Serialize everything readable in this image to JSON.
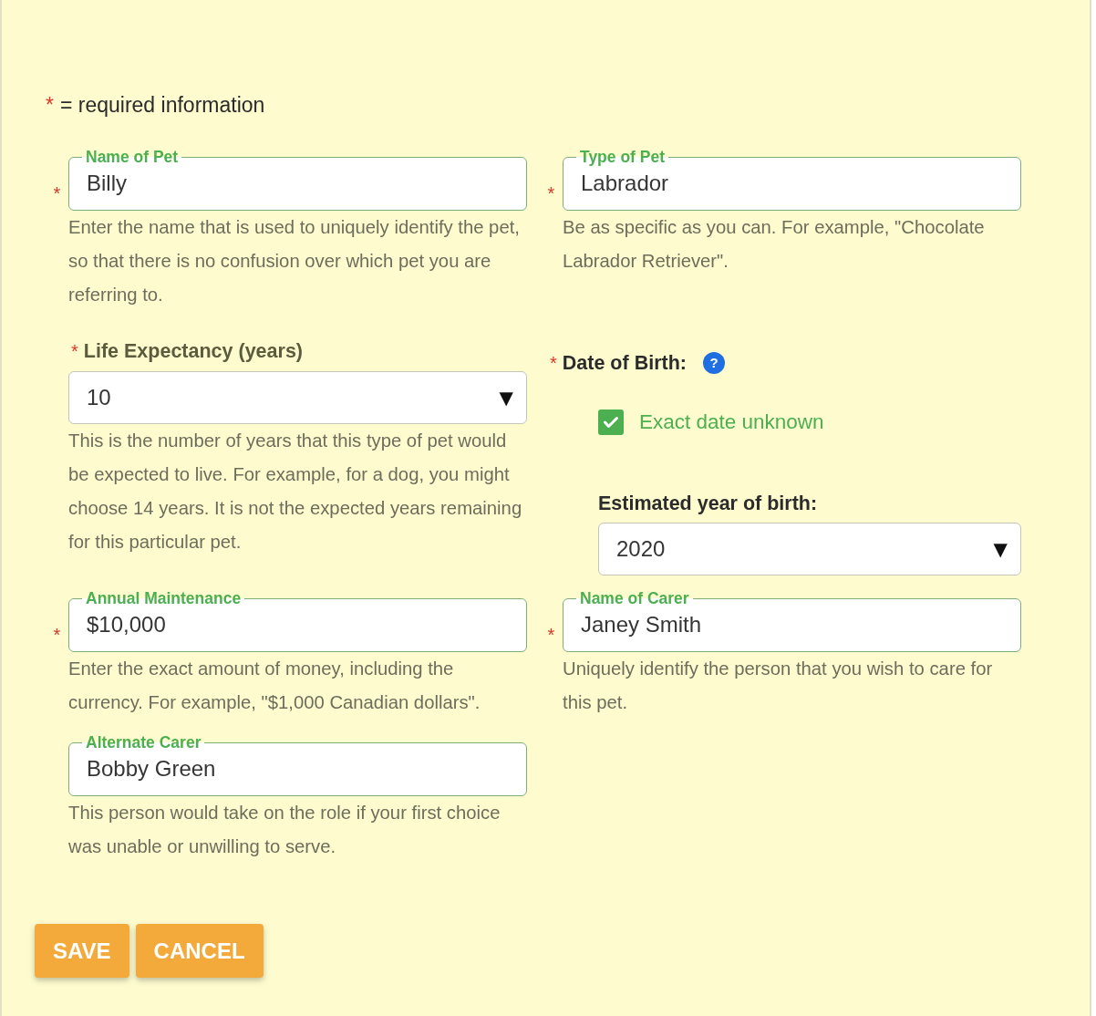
{
  "required_note": {
    "marker": "*",
    "text": "= required information"
  },
  "fields": [
    {
      "kind": "outlined",
      "required_mark": "*",
      "label": "Name of Pet",
      "value": "Billy",
      "helper": "Enter the name that is used to uniquely identify the pet, so that there is no confusion over which pet you are referring to."
    },
    {
      "kind": "outlined",
      "required_mark": "*",
      "label": "Type of Pet",
      "value": "Labrador",
      "helper": "Be as specific as you can. For example, \"Chocolate Labrador Retriever\"."
    },
    {
      "kind": "select",
      "required_mark": "*",
      "label": "Life Expectancy (years)",
      "value": "10",
      "caret": "▼",
      "helper": "This is the number of years that this type of pet would be expected to live. For example, for a dog, you might choose 14 years. It is not the expected years remaining for this particular pet."
    },
    {
      "kind": "date",
      "required_mark": "*",
      "label": "Date of Birth:",
      "help_icon": "?",
      "checkbox": {
        "label": "Exact date unknown",
        "checked": true
      },
      "estimate": {
        "label": "Estimated year of birth:",
        "value": "2020",
        "caret": "▼"
      }
    },
    {
      "kind": "outlined",
      "required_mark": "*",
      "label": "Annual Maintenance",
      "value": "$10,000",
      "helper": "Enter the exact amount of money, including the currency. For example, \"$1,000 Canadian dollars\"."
    },
    {
      "kind": "outlined",
      "required_mark": "*",
      "label": "Name of Carer",
      "value": "Janey Smith",
      "helper": "Uniquely identify the person that you wish to care for this pet."
    },
    {
      "kind": "outlined",
      "label": "Alternate Carer",
      "value": "Bobby Green",
      "helper": "This person would take on the role if your first choice was unable or unwilling to serve."
    }
  ],
  "buttons": [
    {
      "label": "SAVE"
    },
    {
      "label": "CANCEL"
    }
  ]
}
